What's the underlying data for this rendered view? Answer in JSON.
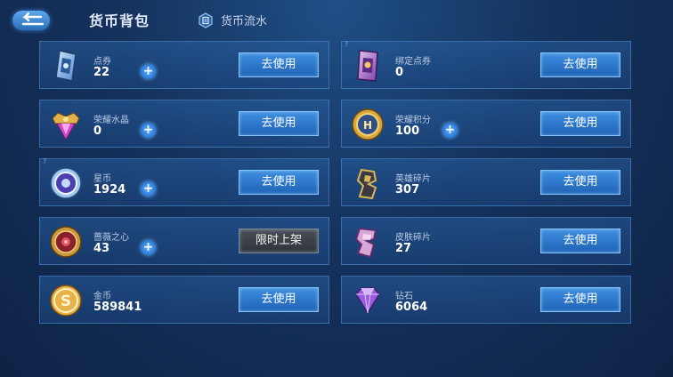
{
  "header": {
    "title": "货币背包",
    "flow_label": "货币流水"
  },
  "colors": {
    "accent": "#2f7ad0",
    "plus": "#4aa0ff"
  },
  "currencies": [
    {
      "name": "点券",
      "amount": "22",
      "button": "去使用",
      "icon": "coupon-card-icon"
    },
    {
      "name": "绑定点券",
      "amount": "0",
      "button": "去使用",
      "icon": "bound-coupon-card-icon"
    },
    {
      "name": "荣耀水晶",
      "amount": "0",
      "button": "去使用",
      "icon": "glory-crystal-icon"
    },
    {
      "name": "荣耀积分",
      "amount": "100",
      "button": "去使用",
      "icon": "glory-points-coin-icon"
    },
    {
      "name": "星币",
      "amount": "1924",
      "button": "去使用",
      "icon": "star-coin-icon"
    },
    {
      "name": "英雄碎片",
      "amount": "307",
      "button": "去使用",
      "icon": "hero-fragment-icon"
    },
    {
      "name": "蔷薇之心",
      "amount": "43",
      "button": "限时上架",
      "icon": "rose-heart-coin-icon"
    },
    {
      "name": "皮肤碎片",
      "amount": "27",
      "button": "去使用",
      "icon": "skin-fragment-icon"
    },
    {
      "name": "金币",
      "amount": "589841",
      "button": "去使用",
      "icon": "gold-coin-icon"
    },
    {
      "name": "钻石",
      "amount": "6064",
      "button": "去使用",
      "icon": "diamond-icon"
    }
  ]
}
